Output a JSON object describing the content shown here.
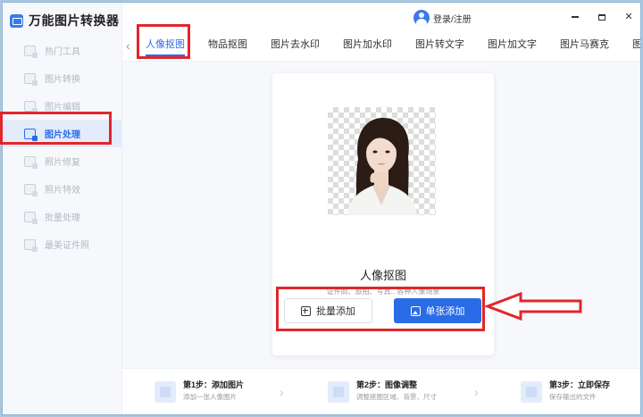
{
  "app": {
    "title": "万能图片转换器"
  },
  "titlebar": {
    "login_label": "登录/注册",
    "minimize": "—",
    "maximize": "□",
    "close": "✕"
  },
  "sidebar": {
    "items": [
      {
        "label": "热门工具"
      },
      {
        "label": "图片转换"
      },
      {
        "label": "图片编辑"
      },
      {
        "label": "图片处理",
        "active": true
      },
      {
        "label": "照片修复"
      },
      {
        "label": "照片特效"
      },
      {
        "label": "批量处理"
      },
      {
        "label": "最美证件照"
      }
    ]
  },
  "tabs": {
    "prev": "‹",
    "items": [
      {
        "label": "人像抠图",
        "active": true
      },
      {
        "label": "物品抠图"
      },
      {
        "label": "图片去水印"
      },
      {
        "label": "图片加水印"
      },
      {
        "label": "图片转文字"
      },
      {
        "label": "图片加文字"
      },
      {
        "label": "图片马赛克"
      },
      {
        "label": "图"
      }
    ]
  },
  "card": {
    "title": "人像抠图",
    "subtitle": "证件照、旅拍、写真...各种人像场景",
    "batch_button": "批量添加",
    "single_button": "单张添加"
  },
  "steps": [
    {
      "title": "第1步：添加图片",
      "desc": "添加一张人像图片"
    },
    {
      "title": "第2步：图像调整",
      "desc": "调整抠图区域、背景、尺寸"
    },
    {
      "title": "第3步：立即保存",
      "desc": "保存输出的文件"
    }
  ],
  "colors": {
    "accent": "#2a6ce8",
    "annotation_red": "#e0262b"
  }
}
